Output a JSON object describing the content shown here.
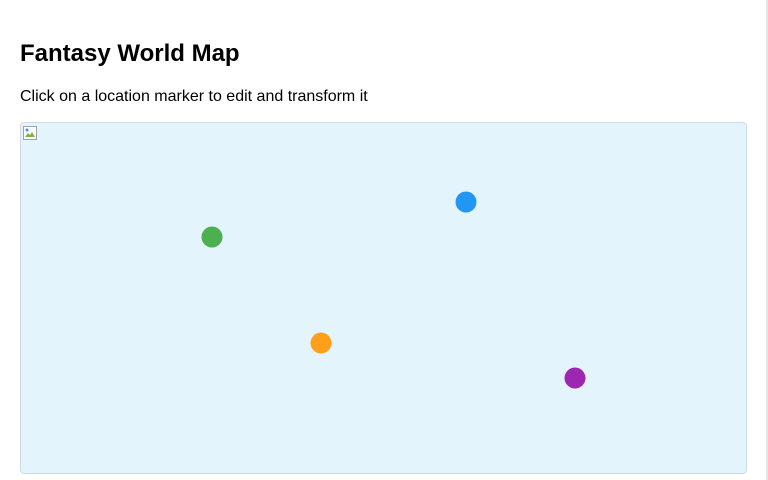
{
  "page": {
    "title": "Fantasy World Map",
    "instructions": "Click on a location marker to edit and transform it"
  },
  "map": {
    "background_color": "#e3f4fd",
    "broken_image_icon": "broken-image-icon",
    "markers": [
      {
        "id": "marker-green",
        "color": "#4caf50"
      },
      {
        "id": "marker-blue",
        "color": "#2196f3"
      },
      {
        "id": "marker-orange",
        "color": "#ff9f1a"
      },
      {
        "id": "marker-purple",
        "color": "#9c27b0"
      }
    ]
  }
}
